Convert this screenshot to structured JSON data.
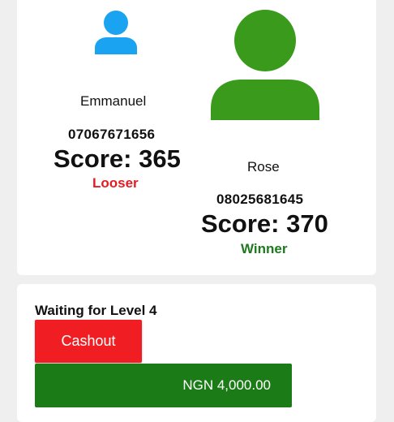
{
  "players": [
    {
      "name": "Emmanuel",
      "phone": "07067671656",
      "score": "Score: 365",
      "result": "Looser",
      "avatar_icon": "person-icon",
      "avatar_color": "#1aa3f0"
    },
    {
      "name": "Rose",
      "phone": "08025681645",
      "score": "Score: 370",
      "result": "Winner",
      "avatar_icon": "person-icon",
      "avatar_color": "#3a9a1c"
    }
  ],
  "colors": {
    "looser": "#e31b23",
    "winner": "#1e7a1e",
    "cashout": "#f01e23",
    "amount": "#1b7c17"
  },
  "level": {
    "title": "Waiting for Level 4",
    "cashout_label": "Cashout",
    "amount_label": "NGN 4,000.00"
  }
}
